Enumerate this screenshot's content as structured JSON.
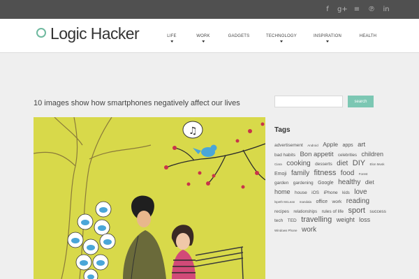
{
  "social": {
    "icons": [
      "facebook-icon",
      "google-plus-icon",
      "rss-icon",
      "pinterest-icon",
      "linkedin-icon"
    ],
    "glyphs": [
      "f",
      "g+",
      "≡",
      "℗",
      "in"
    ]
  },
  "header": {
    "logo_text": "Logic Hacker"
  },
  "nav": {
    "items": [
      {
        "label": "LIFE"
      },
      {
        "label": "WORK"
      },
      {
        "label": "GADGETS"
      },
      {
        "label": "TECHNOLOGY"
      },
      {
        "label": "INSPIRATION"
      },
      {
        "label": "HEALTH"
      }
    ]
  },
  "post": {
    "title": "10 images show how smartphones negatively affect our lives"
  },
  "sidebar": {
    "search": {
      "value": "",
      "button_label": "search"
    },
    "tags_title": "Tags",
    "tags": [
      {
        "label": "advertisement",
        "size": 6.5
      },
      {
        "label": "Android",
        "size": 4.5
      },
      {
        "label": "Apple",
        "size": 8.5
      },
      {
        "label": "apps",
        "size": 7
      },
      {
        "label": "art",
        "size": 9.5
      },
      {
        "label": "bad habits",
        "size": 6.5
      },
      {
        "label": "Bon appetit",
        "size": 9.5
      },
      {
        "label": "celebrities",
        "size": 6
      },
      {
        "label": "children",
        "size": 9
      },
      {
        "label": "Ciara",
        "size": 4.5
      },
      {
        "label": "cooking",
        "size": 10
      },
      {
        "label": "desserts",
        "size": 6.5
      },
      {
        "label": "diet",
        "size": 10
      },
      {
        "label": "DIY",
        "size": 11
      },
      {
        "label": "Elon Musk",
        "size": 4.5
      },
      {
        "label": "Emoji",
        "size": 7
      },
      {
        "label": "family",
        "size": 10
      },
      {
        "label": "fitness",
        "size": 11
      },
      {
        "label": "food",
        "size": 10
      },
      {
        "label": "Forest",
        "size": 4.5
      },
      {
        "label": "garden",
        "size": 6.5
      },
      {
        "label": "gardening",
        "size": 6.5
      },
      {
        "label": "Google",
        "size": 7
      },
      {
        "label": "healthy",
        "size": 10
      },
      {
        "label": "diet",
        "size": 8
      },
      {
        "label": "home",
        "size": 9
      },
      {
        "label": "house",
        "size": 6.5
      },
      {
        "label": "iOS",
        "size": 6.5
      },
      {
        "label": "iPhone",
        "size": 6.5
      },
      {
        "label": "kids",
        "size": 6
      },
      {
        "label": "love",
        "size": 10
      },
      {
        "label": "lspeth McLean",
        "size": 4.5
      },
      {
        "label": "mandala",
        "size": 4.5
      },
      {
        "label": "office",
        "size": 7
      },
      {
        "label": "work",
        "size": 6.5
      },
      {
        "label": "reading",
        "size": 10
      },
      {
        "label": "recipes",
        "size": 6.5
      },
      {
        "label": "relationships",
        "size": 6
      },
      {
        "label": "rules of life",
        "size": 6.5
      },
      {
        "label": "sport",
        "size": 11
      },
      {
        "label": "success",
        "size": 6.5
      },
      {
        "label": "tech",
        "size": 6.5
      },
      {
        "label": "TED",
        "size": 6.5
      },
      {
        "label": "travelling",
        "size": 11
      },
      {
        "label": "weight",
        "size": 9
      },
      {
        "label": "loss",
        "size": 9
      },
      {
        "label": "Windows Phone",
        "size": 4.5
      },
      {
        "label": "work",
        "size": 10
      }
    ]
  },
  "colors": {
    "topbar": "#505050",
    "accent": "#7cc7b3",
    "logo_ring": "#6fb99f",
    "illustration_bg": "#d8d94a",
    "twitter_bird": "#4aa6d8"
  }
}
